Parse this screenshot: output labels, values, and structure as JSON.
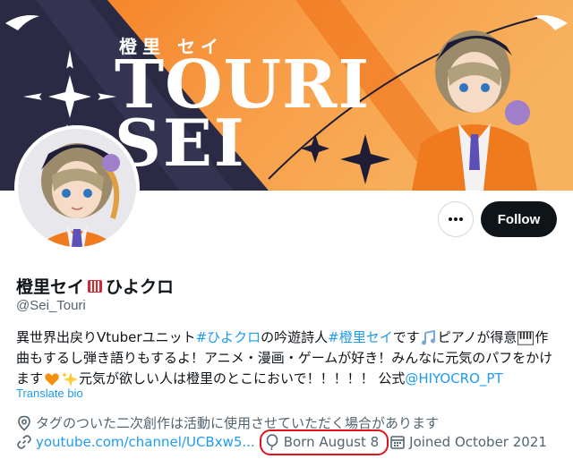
{
  "banner": {
    "name_jp": "橙里 セイ",
    "title_line1": "TOURI",
    "title_line2": "SEI"
  },
  "actions": {
    "more_icon": "more-horizontal-icon",
    "follow_label": "Follow"
  },
  "profile": {
    "display_name_part1": "橙里セイ",
    "display_name_part2": "ひよクロ",
    "handle": "@Sei_Touri"
  },
  "bio": {
    "l1_a": "異世界出戻りVtuberユニット ",
    "l1_tag1": "#ひよクロ",
    "l1_b": " の吟遊詩人 ",
    "l1_tag2": "#橙里セイ",
    "l1_c": " です",
    "l1_d": "ピアノが得意",
    "l1_e": "作",
    "l2": "曲もするし弾き語りもするよ！アニメ・漫画・ゲームが好き！みんなに元気のパフをかけ",
    "l3_a": "ます",
    "l3_b": " 元気が欲しい人は橙里のとこにおいで！！！！！ 公式 ",
    "l3_mention": "@HIYOCRO_PT",
    "translate": "Translate bio"
  },
  "meta": {
    "location": "タグのついた二次創作は活動に使用させていただく場合があります",
    "url": "youtube.com/channel/UCBxw5...",
    "born": "Born August 8",
    "joined": "Joined October 2021"
  },
  "colors": {
    "accent": "#1d9bf0",
    "highlight_ring": "#e2121c",
    "banner_orange": "#f58a1f",
    "banner_navy": "#2b2a44"
  }
}
